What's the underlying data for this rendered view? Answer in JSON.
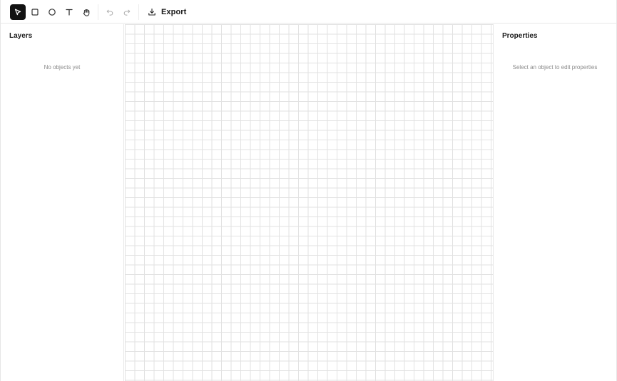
{
  "toolbar": {
    "tools": [
      {
        "icon": "pointer-icon",
        "name": "select-tool",
        "active": true
      },
      {
        "icon": "square-icon",
        "name": "rectangle-tool",
        "active": false
      },
      {
        "icon": "circle-icon",
        "name": "ellipse-tool",
        "active": false
      },
      {
        "icon": "text-icon",
        "name": "text-tool",
        "active": false
      },
      {
        "icon": "hand-icon",
        "name": "pan-tool",
        "active": false
      }
    ],
    "undo_icon": "undo-icon",
    "redo_icon": "redo-icon",
    "export_icon": "download-icon",
    "export_label": "Export"
  },
  "layers_panel": {
    "title": "Layers",
    "empty_text": "No objects yet"
  },
  "properties_panel": {
    "title": "Properties",
    "empty_text": "Select an object to edit properties"
  },
  "colors": {
    "active_tool_bg": "#121212",
    "grid_line": "#e2e2e2",
    "border": "#e7e7e7",
    "muted_text": "#8a8a8a"
  }
}
